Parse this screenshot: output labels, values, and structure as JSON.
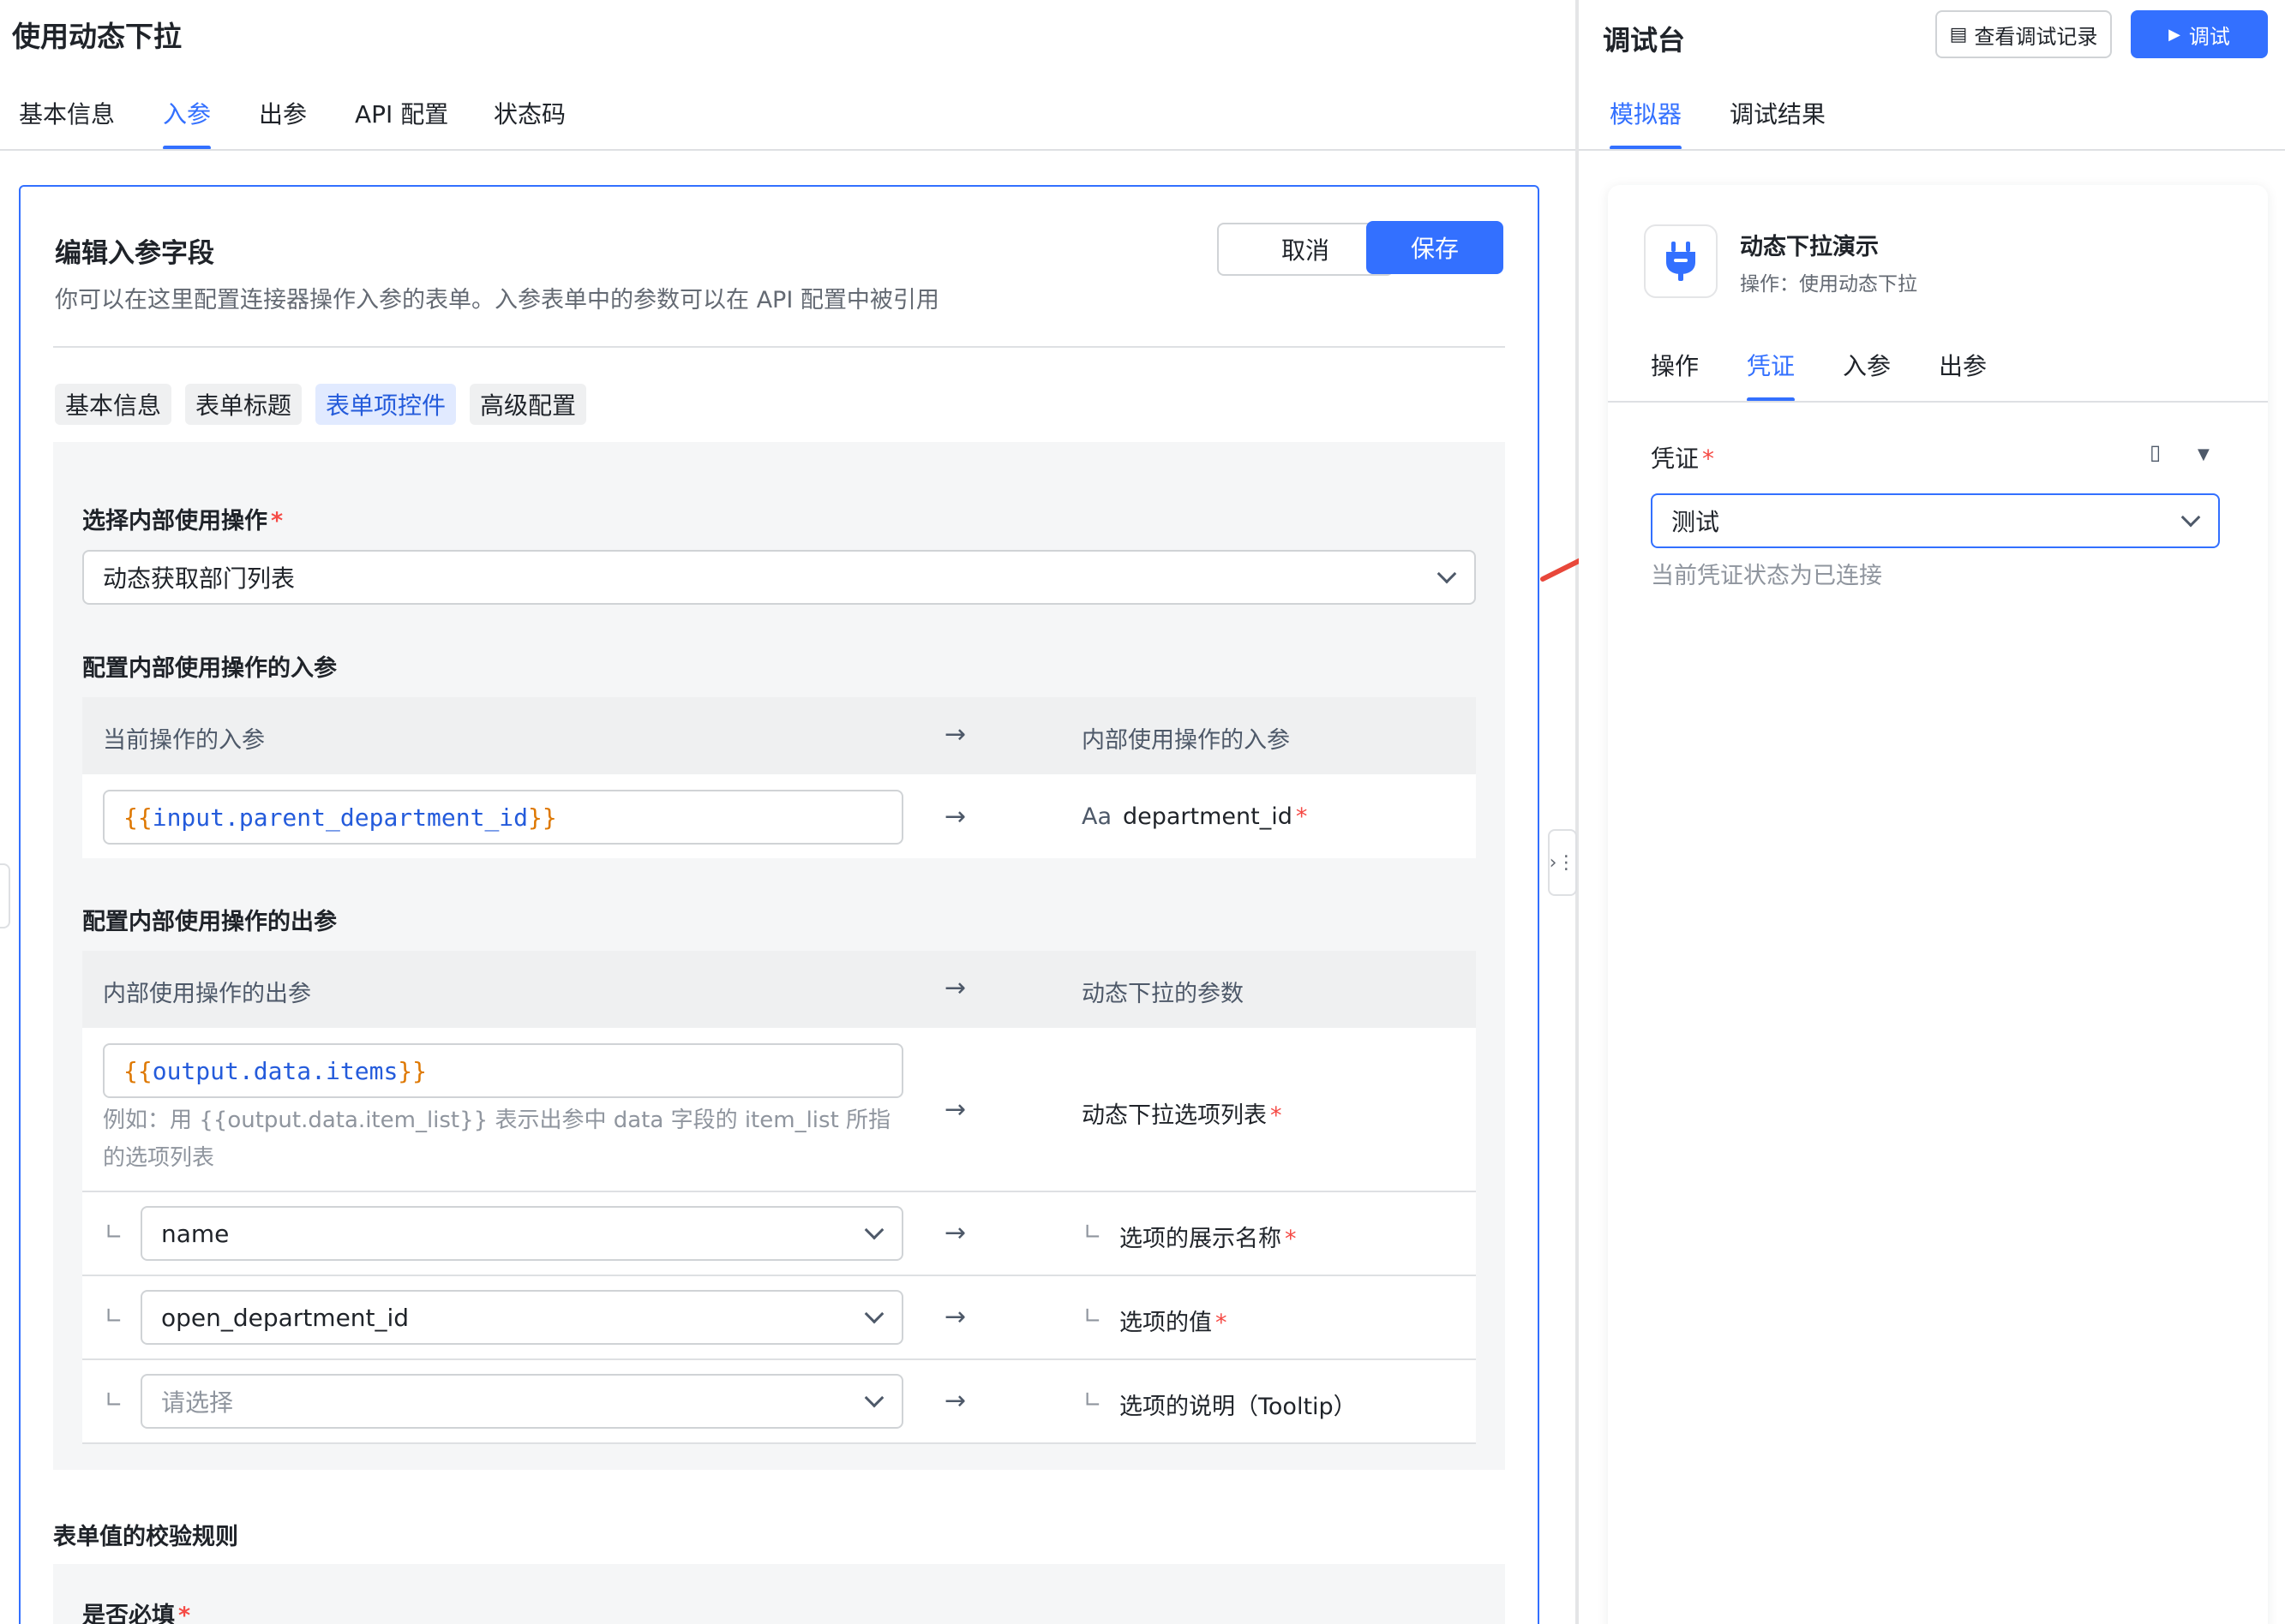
{
  "left": {
    "page_title": "使用动态下拉",
    "tabs": [
      "基本信息",
      "入参",
      "出参",
      "API 配置",
      "状态码"
    ],
    "card": {
      "title": "编辑入参字段",
      "description": "你可以在这里配置连接器操作入参的表单。入参表单中的参数可以在 API 配置中被引用",
      "cancel_label": "取消",
      "save_label": "保存",
      "segments": [
        "基本信息",
        "表单标题",
        "表单项控件",
        "高级配置"
      ],
      "internal_op_label": "选择内部使用操作",
      "internal_op_value": "动态获取部门列表",
      "input_section": "配置内部使用操作的入参",
      "input_head_left": "当前操作的入参",
      "input_head_right": "内部使用操作的入参",
      "input_expr_var": "input.parent_department_id",
      "input_target_icon": "Aa",
      "input_target": "department_id",
      "output_section": "配置内部使用操作的出参",
      "output_head_left": "内部使用操作的出参",
      "output_head_right": "动态下拉的参数",
      "output_expr_var": "output.data.items",
      "output_hint": "例如：用 {{output.data.item_list}} 表示出参中 data 字段的 item_list 所指的选项列表",
      "output_target": "动态下拉选项列表",
      "rows": [
        {
          "value": "name",
          "target": "选项的展示名称",
          "required": true
        },
        {
          "value": "open_department_id",
          "target": "选项的值",
          "required": true
        },
        {
          "placeholder": "请选择",
          "target": "选项的说明（Tooltip）",
          "required": false
        }
      ],
      "validation_title": "表单值的校验规则",
      "required_label": "是否必填"
    },
    "arrow_symbol": "→",
    "corner_symbol": "∟",
    "required_mark": "*"
  },
  "right": {
    "title": "调试台",
    "history_label": "查看调试记录",
    "debug_label": "调试",
    "tabs": [
      "模拟器",
      "调试结果"
    ],
    "demo_title": "动态下拉演示",
    "demo_subtitle": "操作：使用动态下拉",
    "sub_tabs": [
      "操作",
      "凭证",
      "入参",
      "出参"
    ],
    "credential_label": "凭证",
    "credential_value": "测试",
    "credential_status": "当前凭证状态为已连接"
  },
  "colors": {
    "accent": "#3370ff",
    "required": "#f54a45",
    "annotation_arrow": "#e8473a",
    "expression_brace": "#de7802",
    "expression_var": "#245bdb"
  }
}
